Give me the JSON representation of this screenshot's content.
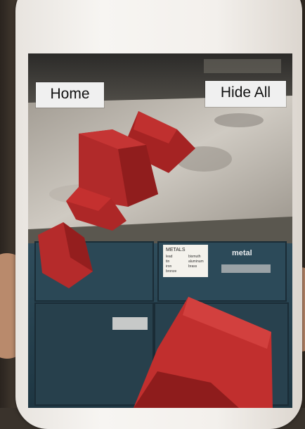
{
  "buttons": {
    "home_label": "Home",
    "hide_all_label": "Hide All"
  },
  "scene": {
    "note_title": "METALS",
    "note_lines": [
      "lead",
      "tin",
      "iron",
      "bronze",
      "bismuth",
      "aluminum",
      "brass"
    ],
    "drawer_label": "metal"
  },
  "colors": {
    "cube_red": "#b22a2a",
    "button_bg": "#f0f0f0"
  }
}
